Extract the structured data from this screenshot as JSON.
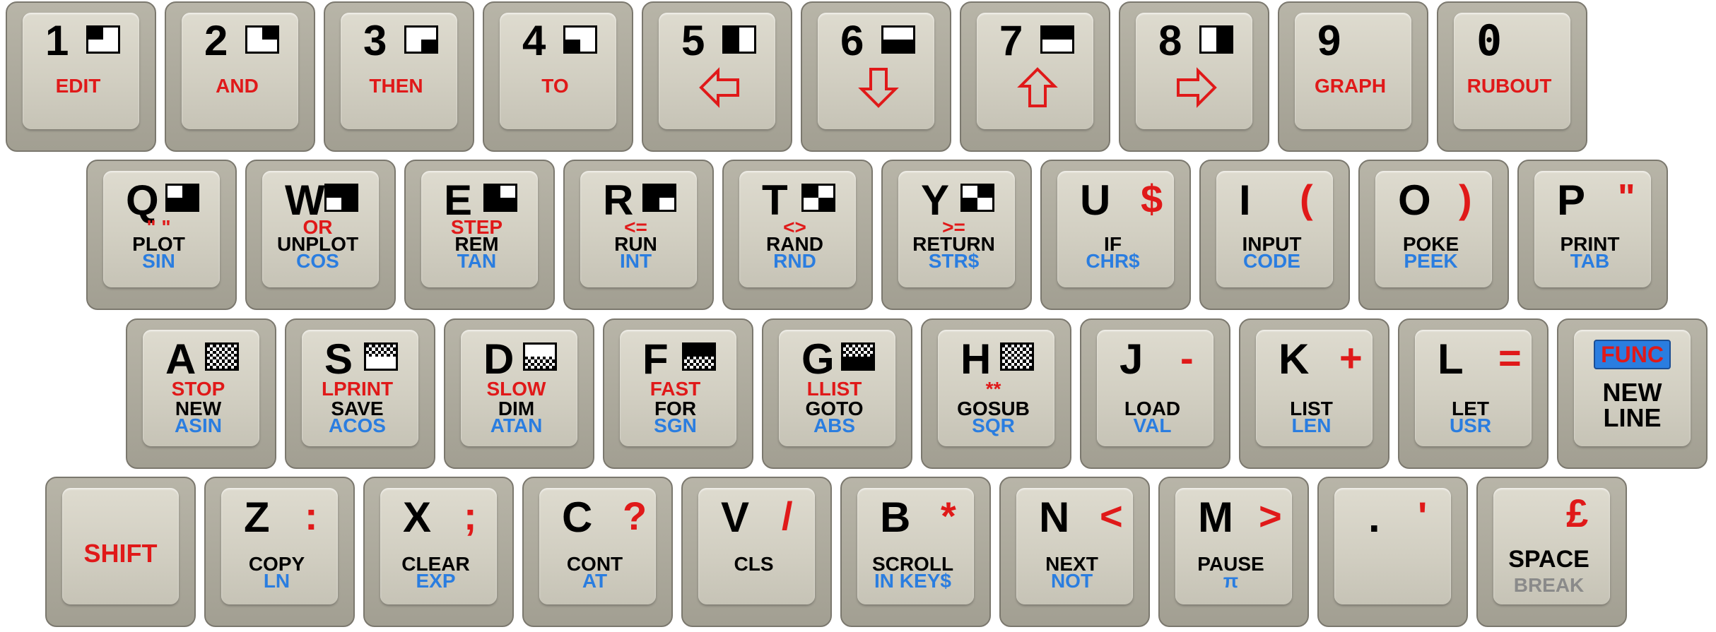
{
  "keyboard": {
    "row1": [
      {
        "main": "1",
        "kw": "EDIT"
      },
      {
        "main": "2",
        "kw": "AND"
      },
      {
        "main": "3",
        "kw": "THEN"
      },
      {
        "main": "4",
        "kw": "TO"
      },
      {
        "main": "5",
        "arrow": "left"
      },
      {
        "main": "6",
        "arrow": "down"
      },
      {
        "main": "7",
        "arrow": "up"
      },
      {
        "main": "8",
        "arrow": "right"
      },
      {
        "main": "9",
        "kw": "GRAPH"
      },
      {
        "main": "0",
        "kw": "RUBOUT"
      }
    ],
    "row2": [
      {
        "main": "Q",
        "shift": "\" \"",
        "kw": "PLOT",
        "fn": "SIN"
      },
      {
        "main": "W",
        "shift": "OR",
        "kw": "UNPLOT",
        "fn": "COS"
      },
      {
        "main": "E",
        "shift": "STEP",
        "kw": "REM",
        "fn": "TAN"
      },
      {
        "main": "R",
        "shift": "<=",
        "kw": "RUN",
        "fn": "INT"
      },
      {
        "main": "T",
        "shift": "<>",
        "kw": "RAND",
        "fn": "RND"
      },
      {
        "main": "Y",
        "shift": ">=",
        "kw": "RETURN",
        "fn": "STR$"
      },
      {
        "main": "U",
        "sym": "$",
        "kw": "IF",
        "fn": "CHR$"
      },
      {
        "main": "I",
        "sym": "(",
        "kw": "INPUT",
        "fn": "CODE"
      },
      {
        "main": "O",
        "sym": ")",
        "kw": "POKE",
        "fn": "PEEK"
      },
      {
        "main": "P",
        "sym": "\"",
        "kw": "PRINT",
        "fn": "TAB"
      }
    ],
    "row3": [
      {
        "main": "A",
        "shift": "STOP",
        "kw": "NEW",
        "fn": "ASIN"
      },
      {
        "main": "S",
        "shift": "LPRINT",
        "kw": "SAVE",
        "fn": "ACOS"
      },
      {
        "main": "D",
        "shift": "SLOW",
        "kw": "DIM",
        "fn": "ATAN"
      },
      {
        "main": "F",
        "shift": "FAST",
        "kw": "FOR",
        "fn": "SGN"
      },
      {
        "main": "G",
        "shift": "LLIST",
        "kw": "GOTO",
        "fn": "ABS"
      },
      {
        "main": "H",
        "shift": "**",
        "kw": "GOSUB",
        "fn": "SQR"
      },
      {
        "main": "J",
        "sym": "-",
        "kw": "LOAD",
        "fn": "VAL"
      },
      {
        "main": "K",
        "sym": "+",
        "kw": "LIST",
        "fn": "LEN"
      },
      {
        "main": "L",
        "sym": "=",
        "kw": "LET",
        "fn": "USR"
      },
      {
        "func": "FUNC",
        "line1": "NEW",
        "line2": "LINE"
      }
    ],
    "row4": [
      {
        "shiftkey": "SHIFT"
      },
      {
        "main": "Z",
        "sym": ":",
        "kw": "COPY",
        "fn": "LN"
      },
      {
        "main": "X",
        "sym": ";",
        "kw": "CLEAR",
        "fn": "EXP"
      },
      {
        "main": "C",
        "sym": "?",
        "kw": "CONT",
        "fn": "AT"
      },
      {
        "main": "V",
        "sym": "/",
        "kw": "CLS",
        "fn": ""
      },
      {
        "main": "B",
        "sym": "*",
        "kw": "SCROLL",
        "fn": "IN KEY$"
      },
      {
        "main": "N",
        "sym": "<",
        "kw": "NEXT",
        "fn": "NOT"
      },
      {
        "main": "M",
        "sym": ">",
        "kw": "PAUSE",
        "fn": "π"
      },
      {
        "main": ".",
        "sym": "'"
      },
      {
        "sym": "£",
        "kw": "SPACE",
        "fn": "BREAK"
      }
    ]
  },
  "colors": {
    "red": "#e01919",
    "blue": "#2a7de0",
    "key": "#d2cfc2"
  }
}
